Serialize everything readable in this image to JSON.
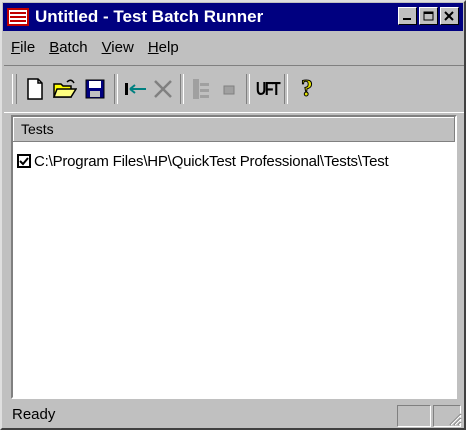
{
  "window": {
    "title": "Untitled - Test Batch Runner",
    "titlebar_color": "#000080",
    "buttons": [
      "minimize-icon",
      "maximize-icon",
      "close-icon"
    ]
  },
  "menu": {
    "items": [
      {
        "key": "F",
        "rest": "ile"
      },
      {
        "key": "B",
        "rest": "atch"
      },
      {
        "key": "V",
        "rest": "iew"
      },
      {
        "key": "H",
        "rest": "elp"
      }
    ]
  },
  "toolbar": {
    "buttons": [
      "new-file-icon",
      "open-folder-icon",
      "save-icon",
      "add-test-icon",
      "remove-test-icon",
      "run-icon",
      "stop-icon",
      "uft-icon",
      "help-icon"
    ],
    "uft_label": "UFT",
    "help_label": "?"
  },
  "tests": {
    "header": "Tests",
    "rows": [
      {
        "checked": true,
        "path": "C:\\Program Files\\HP\\QuickTest Professional\\Tests\\Test"
      }
    ]
  },
  "status": {
    "text": "Ready"
  }
}
